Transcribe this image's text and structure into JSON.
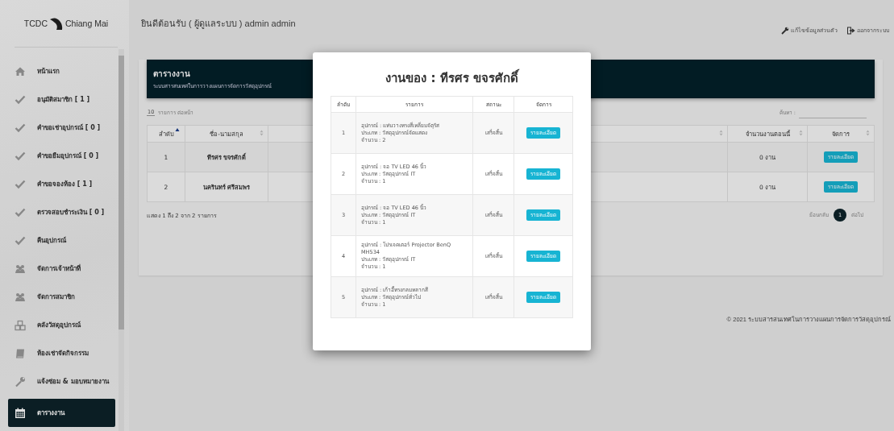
{
  "sidebar": {
    "logo": {
      "left": "TCDC",
      "right": "Chiang Mai"
    },
    "items": [
      {
        "label": "หน้าแรก",
        "selected": false
      },
      {
        "label": "อนุมัติสมาชิก [ 1 ]",
        "selected": false
      },
      {
        "label": "คำขอเช่าอุปกรณ์ [ 0 ]",
        "selected": false
      },
      {
        "label": "คำขอยืมอุปกรณ์ [ 0 ]",
        "selected": false
      },
      {
        "label": "คำขอจองห้อง [ 1 ]",
        "selected": false
      },
      {
        "label": "ตรวจสอบชำระเงิน [ 0 ]",
        "selected": false
      },
      {
        "label": "คืนอุปกรณ์",
        "selected": false
      },
      {
        "label": "จัดการเจ้าหน้าที่",
        "selected": false
      },
      {
        "label": "จัดการสมาชิก",
        "selected": false
      },
      {
        "label": "คลังวัสดุอุปกรณ์",
        "selected": false
      },
      {
        "label": "ห้องเช่าจัดกิจกรรม",
        "selected": false
      },
      {
        "label": "แจ้งซ่อม & มอบหมายงาน",
        "selected": false
      },
      {
        "label": "ตารางงาน",
        "selected": true
      }
    ]
  },
  "header": {
    "welcome": "ยินดีต้อนรับ ( ผู้ดูแลระบบ ) admin admin",
    "links": [
      "แก้ไขข้อมูลส่วนตัว",
      "ออกจากระบบ"
    ]
  },
  "panel": {
    "title": "ตารางงาน",
    "subtitle": "ระบบสารสนเทศในการวางแผนการจัดการวัสดุอุปกรณ์"
  },
  "table_controls": {
    "page_size": "10",
    "page_size_label": "รายการ ต่อหน้า",
    "search_label": "ค้นหา :"
  },
  "table": {
    "columns": [
      {
        "kind": "label",
        "label": "ลำดับ",
        "sorted": true
      },
      {
        "kind": "label",
        "label": "ชื่อ-นามสกุล",
        "sorted": false
      },
      {
        "kind": "covered",
        "sorted": false
      },
      {
        "kind": "label",
        "label": "จำนวนงานตอนนี้",
        "sorted": false
      },
      {
        "kind": "label",
        "label": "จัดการ",
        "sorted": false
      }
    ],
    "rows": [
      {
        "number": "1",
        "name": "ทีรศร ขจรศักดิ์",
        "jobs": "0 งาน",
        "action": "รายละเอียด"
      },
      {
        "number": "2",
        "name": "นครินทร์ ศรีสมพร",
        "jobs": "0 งาน",
        "action": "รายละเอียด"
      }
    ]
  },
  "info": "แสดง 1 ถึง 2 จาก 2 รายการ",
  "pagination": {
    "prev": "ย้อนกลับ",
    "pages": [
      {
        "label": "1",
        "selected": true
      }
    ],
    "next": "ต่อไป"
  },
  "footer": "© 2021 ระบบสารสนเทศในการวางแผนการจัดการวัสดุอุปกรณ์",
  "modal": {
    "title": "งานของ : ทีรศร ขจรศักดิ์",
    "columns": [
      "ลำดับ",
      "รายการ",
      "สถานะ",
      "จัดการ"
    ],
    "rows": [
      {
        "number": "1",
        "lines": [
          "อุปกรณ์ : แท่นวางทรงสี่เหลี่ยมจัตุรัส",
          "ประเภท : วัสดุอุปกรณ์จัดแสดง",
          "จำนวน : 2"
        ],
        "status": "เสร็จสิ้น",
        "action": "รายละเอียด"
      },
      {
        "number": "2",
        "lines": [
          "อุปกรณ์ : จอ TV LED 46 นิ้ว",
          "ประเภท : วัสดุอุปกรณ์ IT",
          "จำนวน : 1"
        ],
        "status": "เสร็จสิ้น",
        "action": "รายละเอียด"
      },
      {
        "number": "3",
        "lines": [
          "อุปกรณ์ : จอ TV LED 46 นิ้ว",
          "ประเภท : วัสดุอุปกรณ์ IT",
          "จำนวน : 1"
        ],
        "status": "เสร็จสิ้น",
        "action": "รายละเอียด"
      },
      {
        "number": "4",
        "lines": [
          "อุปกรณ์ : โปรเจคเตอร์ Projector BenQ MH534",
          "ประเภท : วัสดุอุปกรณ์ IT",
          "จำนวน : 1"
        ],
        "status": "เสร็จสิ้น",
        "action": "รายละเอียด"
      },
      {
        "number": "5",
        "lines": [
          "อุปกรณ์ : เก้าอี้ทรงกลมหลากสี",
          "ประเภท : วัสดุอุปกรณ์ทั่วไป",
          "จำนวน : 1"
        ],
        "status": "เสร็จสิ้น",
        "action": "รายละเอียด"
      }
    ]
  }
}
